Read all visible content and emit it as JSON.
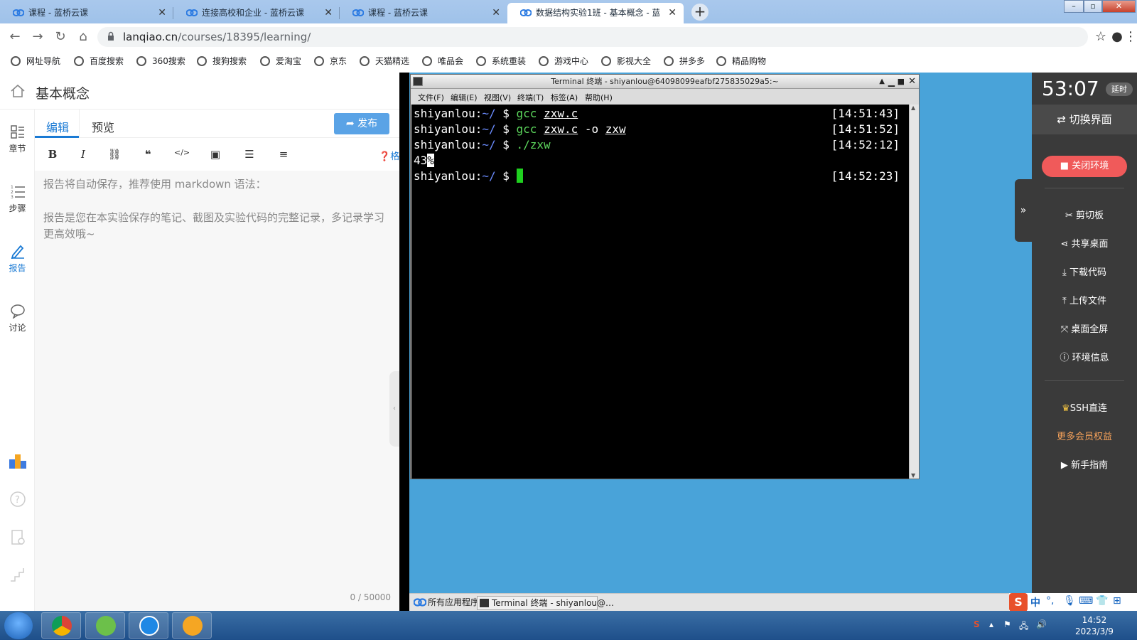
{
  "browser": {
    "tabs": [
      {
        "title": "课程 - 蓝桥云课",
        "active": false
      },
      {
        "title": "连接高校和企业 - 蓝桥云课",
        "active": false
      },
      {
        "title": "课程 - 蓝桥云课",
        "active": false
      },
      {
        "title": "数据结构实验1班 - 基本概念 - 蓝",
        "active": true
      }
    ],
    "url_host": "lanqiao.cn",
    "url_path": "/courses/18395/learning/",
    "bookmarks": [
      "网址导航",
      "百度搜索",
      "360搜索",
      "搜狗搜索",
      "爱淘宝",
      "京东",
      "天猫精选",
      "唯品会",
      "系统重装",
      "游戏中心",
      "影视大全",
      "拼多多",
      "精品购物"
    ]
  },
  "page": {
    "title": "基本概念",
    "rail": {
      "chapters": "章节",
      "steps": "步骤",
      "report": "报告",
      "discuss": "讨论"
    },
    "editor_tabs": {
      "edit": "编辑",
      "preview": "预览"
    },
    "publish": "发布",
    "toolbar": {
      "bold": "B",
      "italic": "I",
      "format_help": "格式说明"
    },
    "placeholder_line1": "报告将自动保存，推荐使用 markdown 语法：",
    "placeholder_line2": "报告是您在本实验保存的笔记、截图及实验代码的完整记录，多记录学习更高效哦~",
    "char_count": "0 / 50000"
  },
  "terminal": {
    "title": "Terminal 终端 - shiyanlou@64098099eafbf275835029a5:~",
    "menu": [
      "文件(F)",
      "编辑(E)",
      "视图(V)",
      "终端(T)",
      "标签(A)",
      "帮助(H)"
    ],
    "prompt_user": "shiyanlou:",
    "prompt_path": "~/",
    "prompt_symbol": "$",
    "lines": [
      {
        "cmd": "gcc",
        "args": "zxw.c",
        "extra": "",
        "time": "[14:51:43]"
      },
      {
        "cmd": "gcc",
        "args": "zxw.c",
        "extra": "-o",
        "extra2": "zxw",
        "time": "[14:51:52]"
      },
      {
        "cmd": "./zxw",
        "time": "[14:52:12]"
      }
    ],
    "output": "43",
    "output_mark": "%",
    "last_time": "[14:52:23]"
  },
  "desktop_taskbar": {
    "apps": "所有应用程序",
    "terminal": "Terminal 终端 - shiyanlou@…"
  },
  "panel": {
    "timer": "53:07",
    "delay": "延时",
    "switch_ui": "切换界面",
    "close_env": "关闭环境",
    "items": [
      "剪切板",
      "共享桌面",
      "下载代码",
      "上传文件",
      "桌面全屏",
      "环境信息"
    ],
    "ssh": "SSH直连",
    "vip": "更多会员权益",
    "guide": "新手指南"
  },
  "ime": {
    "lang": "中"
  },
  "system": {
    "time": "14:52",
    "date": "2023/3/9"
  }
}
